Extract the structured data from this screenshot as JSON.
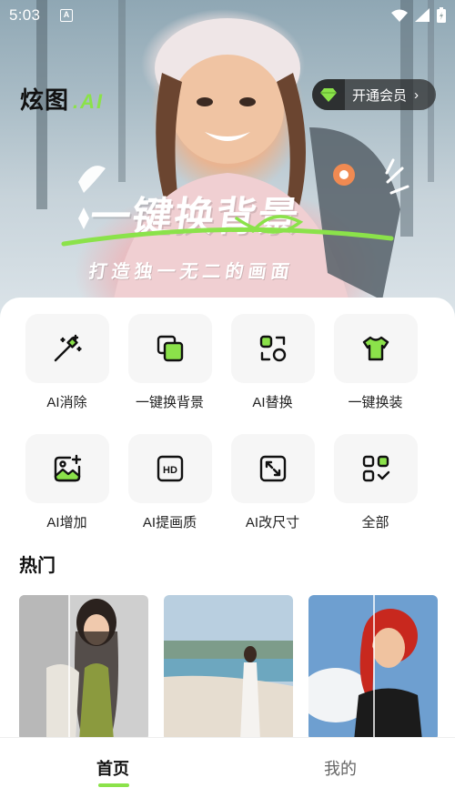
{
  "status_bar": {
    "time": "5:03",
    "notif": "A"
  },
  "header": {
    "logo_cn": "炫图",
    "logo_ai": ".AI",
    "vip_label": "开通会员"
  },
  "banner": {
    "title": "一键换背景",
    "subtitle": "打造独一无二的画面"
  },
  "tools": [
    {
      "label": "AI消除",
      "icon": "magic-wand-icon"
    },
    {
      "label": "一键换背景",
      "icon": "layers-icon"
    },
    {
      "label": "AI替换",
      "icon": "swap-shapes-icon"
    },
    {
      "label": "一键换装",
      "icon": "shirt-icon"
    },
    {
      "label": "AI增加",
      "icon": "image-add-icon"
    },
    {
      "label": "AI提画质",
      "icon": "hd-icon"
    },
    {
      "label": "AI改尺寸",
      "icon": "resize-icon"
    },
    {
      "label": "全部",
      "icon": "grid-all-icon"
    }
  ],
  "section": {
    "hot_title": "热门"
  },
  "nav": {
    "home": "首页",
    "mine": "我的"
  },
  "colors": {
    "accent": "#8be24a",
    "card_bg": "#f6f6f6"
  }
}
